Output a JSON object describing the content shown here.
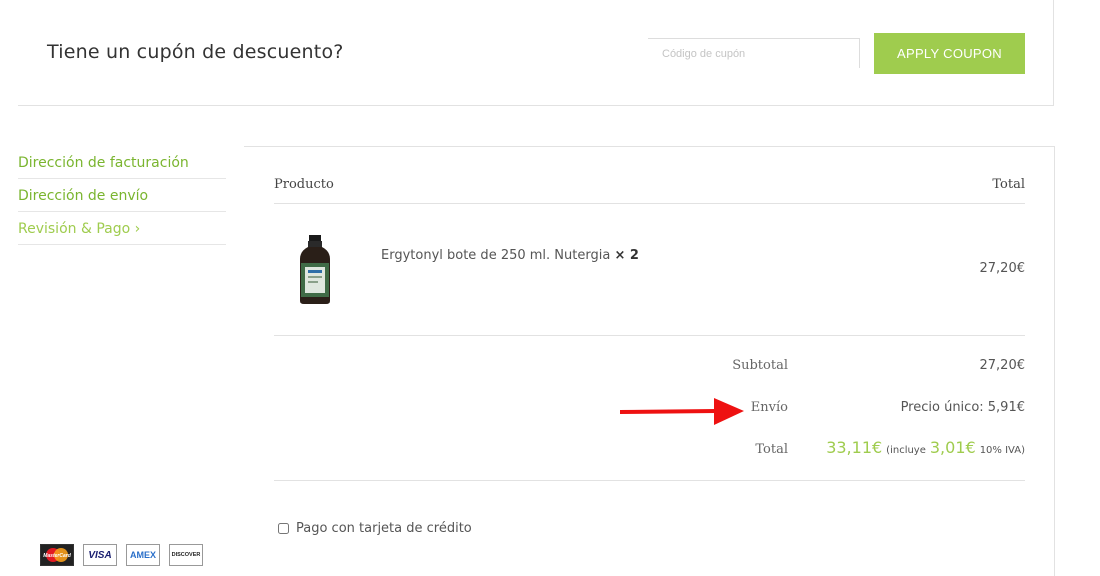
{
  "coupon": {
    "title": "Tiene un cupón de descuento?",
    "placeholder": "Código de cupón",
    "button": "APPLY COUPON"
  },
  "steps": [
    {
      "label": "Dirección de facturación"
    },
    {
      "label": "Dirección de envío"
    },
    {
      "label": "Revisión & Pago ›"
    }
  ],
  "order": {
    "header": {
      "product": "Producto",
      "total": "Total"
    },
    "item": {
      "name": "Ergytonyl bote de 250 ml. Nutergia",
      "qty": "× 2",
      "total": "27,20€"
    },
    "subtotal": {
      "label": "Subtotal",
      "value": "27,20€"
    },
    "shipping": {
      "label": "Envío",
      "value": "Precio único: 5,91€"
    },
    "total": {
      "label": "Total",
      "amount": "33,11€",
      "includes": "(incluye",
      "tax": "3,01€",
      "tax_label": "10% IVA)"
    }
  },
  "payment": {
    "option": "Pago con tarjeta de crédito"
  },
  "cards": [
    "MasterCard",
    "VISA",
    "AMEX",
    "DISCOVER"
  ],
  "colors": {
    "accent": "#9fcc4e",
    "link": "#7ab52f",
    "arrow": "#ee1111"
  }
}
